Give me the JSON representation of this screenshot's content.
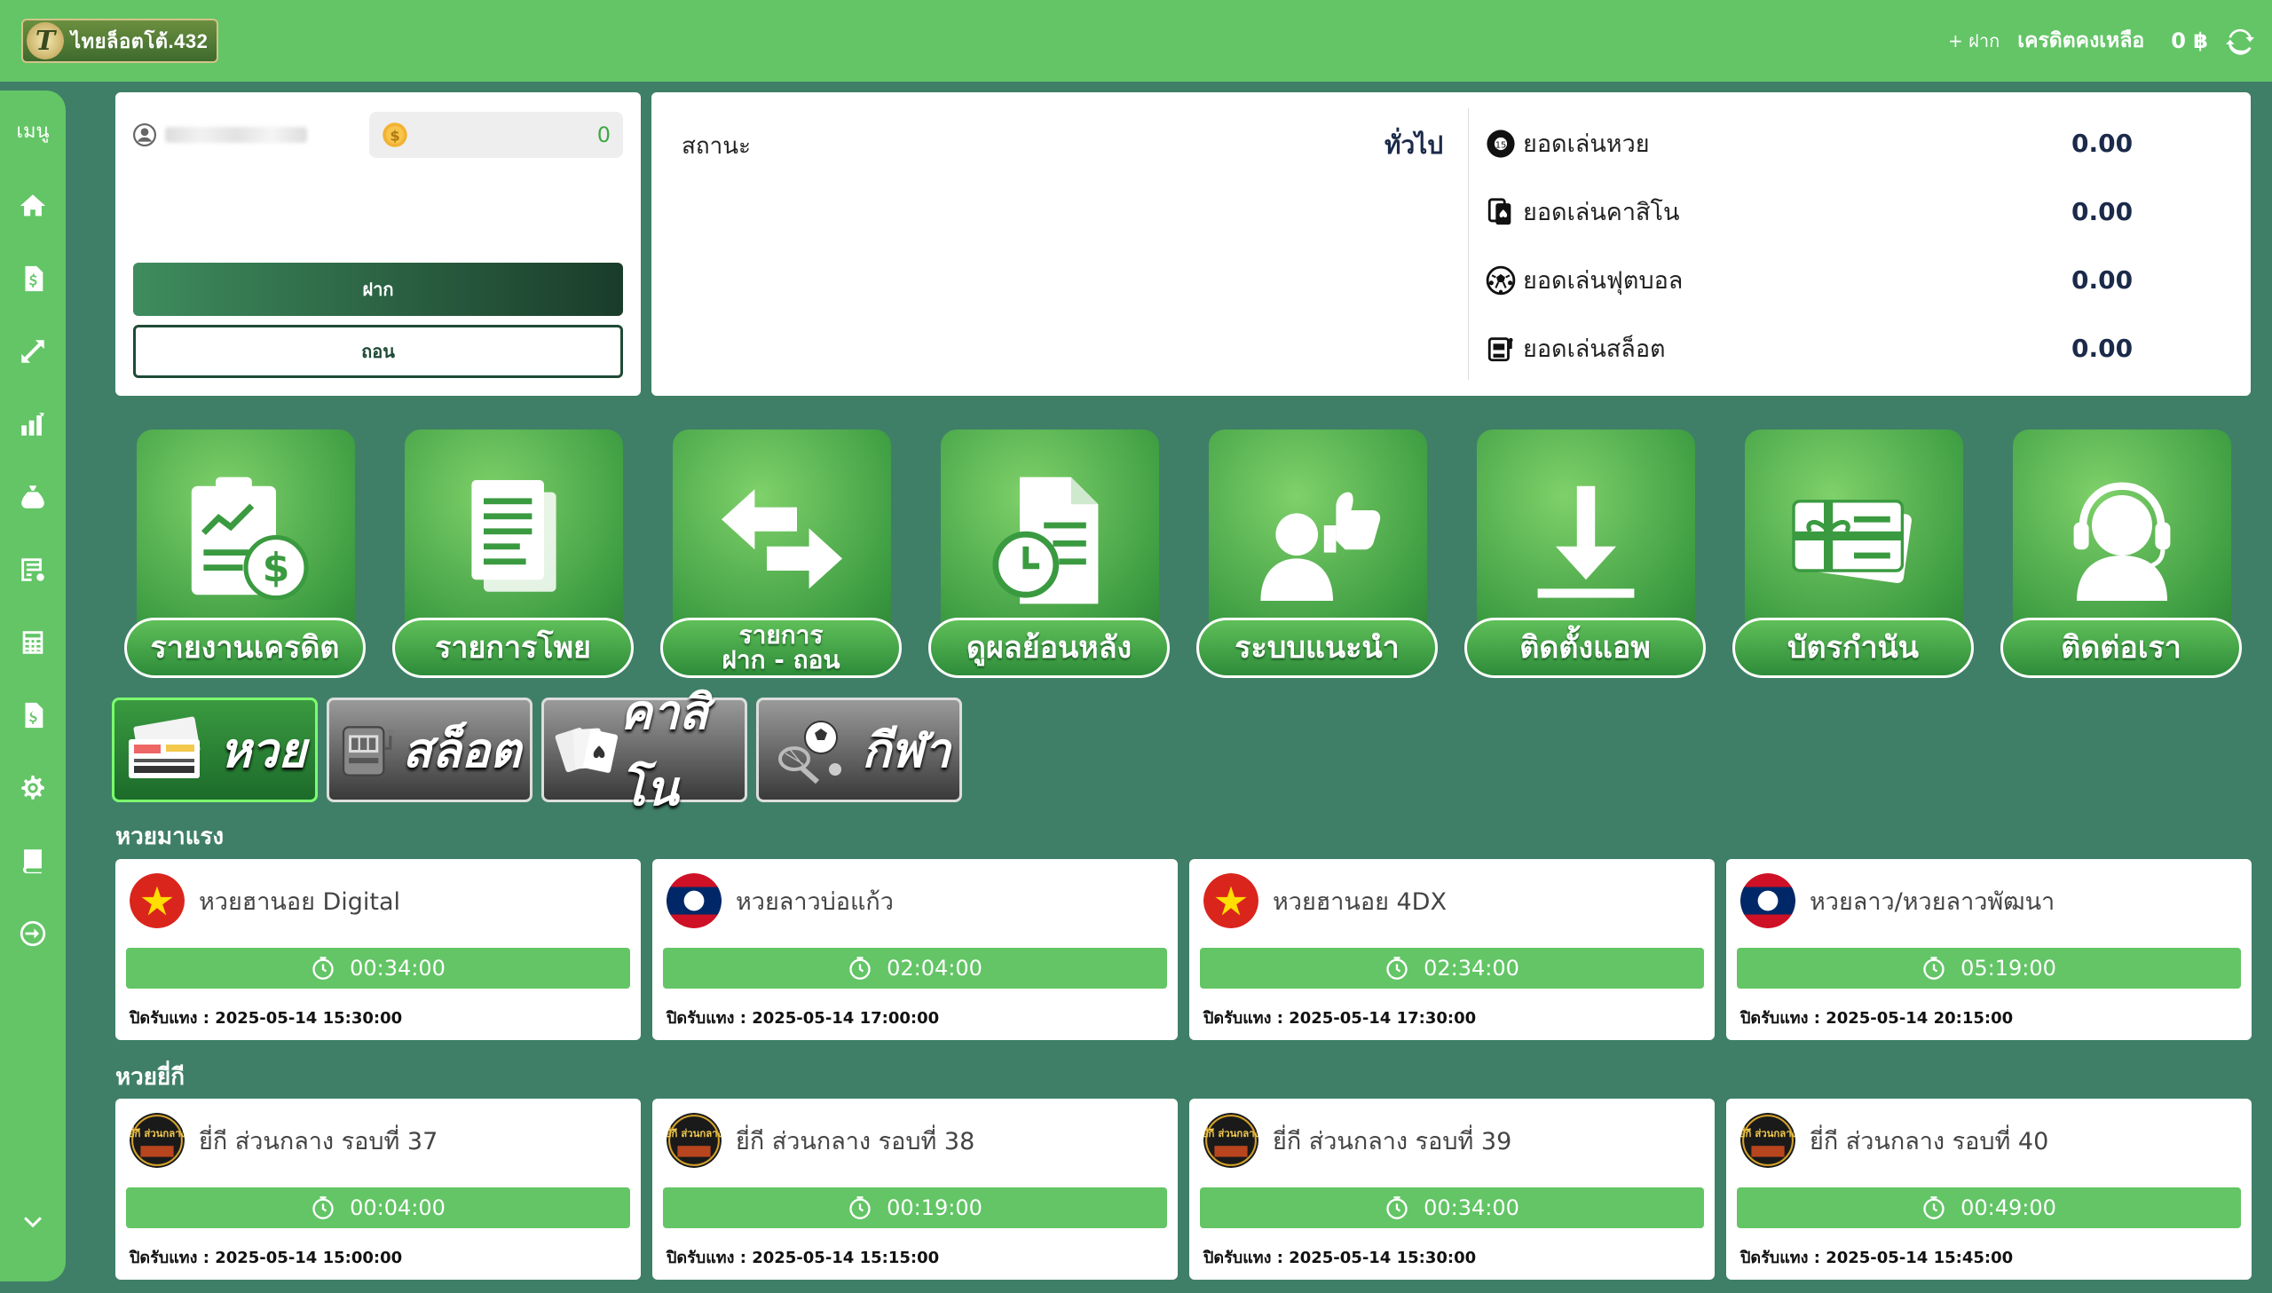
{
  "header": {
    "logo_text": "ไทยล็อตโต้.432",
    "deposit_link": "+ ฝาก",
    "credit_label": "เครดิตคงเหลือ",
    "credit_value": "0 ฿"
  },
  "sidebar": {
    "menu_label": "เมนู",
    "items": [
      "home-icon",
      "bill-icon",
      "transfer-icon",
      "chart-icon",
      "money-bag-icon",
      "list-icon",
      "calculator-icon",
      "document-dollar-icon",
      "settings-icon",
      "book-icon",
      "logout-icon"
    ]
  },
  "profile": {
    "balance": "0",
    "deposit_button": "ฝาก",
    "withdraw_button": "ถอน"
  },
  "status": {
    "label": "สถานะ",
    "type": "ทั่วไป",
    "stats": [
      {
        "label": "ยอดเล่นหวย",
        "value": "0.00",
        "icon": "lottery-ball-icon"
      },
      {
        "label": "ยอดเล่นคาสิโน",
        "value": "0.00",
        "icon": "cards-icon"
      },
      {
        "label": "ยอดเล่นฟุตบอล",
        "value": "0.00",
        "icon": "soccer-ball-icon"
      },
      {
        "label": "ยอดเล่นสล็อต",
        "value": "0.00",
        "icon": "slot-machine-icon"
      }
    ]
  },
  "tiles": [
    {
      "label": "รายงานเครดิต",
      "icon": "credit-report-icon"
    },
    {
      "label": "รายการโพย",
      "icon": "documents-icon"
    },
    {
      "label": "รายการ\nฝาก - ถอน",
      "icon": "exchange-arrows-icon"
    },
    {
      "label": "ดูผลย้อนหลัง",
      "icon": "history-document-icon"
    },
    {
      "label": "ระบบแนะนำ",
      "icon": "referral-icon"
    },
    {
      "label": "ติดตั้งแอพ",
      "icon": "download-icon"
    },
    {
      "label": "บัตรกำนัน",
      "icon": "gift-card-icon"
    },
    {
      "label": "ติดต่อเรา",
      "icon": "support-agent-icon"
    }
  ],
  "tabs": [
    {
      "label": "หวย",
      "icon": "lottery-ticket-icon",
      "active": true
    },
    {
      "label": "สล็อต",
      "icon": "slot-machine-icon",
      "active": false
    },
    {
      "label": "คาสิโน",
      "icon": "playing-cards-icon",
      "active": false
    },
    {
      "label": "กีฬา",
      "icon": "sports-icon",
      "active": false
    }
  ],
  "sections": [
    {
      "title": "หวยมาแรง",
      "cards": [
        {
          "name": "หวยฮานอย Digital",
          "flag": "vietnam",
          "timer": "00:34:00",
          "close": "ปิดรับแทง : 2025-05-14 15:30:00"
        },
        {
          "name": "หวยลาวบ่อแก้ว",
          "flag": "laos",
          "timer": "02:04:00",
          "close": "ปิดรับแทง : 2025-05-14 17:00:00"
        },
        {
          "name": "หวยฮานอย 4DX",
          "flag": "vietnam",
          "timer": "02:34:00",
          "close": "ปิดรับแทง : 2025-05-14 17:30:00"
        },
        {
          "name": "หวยลาว/หวยลาวพัฒนา",
          "flag": "laos",
          "timer": "05:19:00",
          "close": "ปิดรับแทง : 2025-05-14 20:15:00"
        }
      ]
    },
    {
      "title": "หวยยี่กี",
      "cards": [
        {
          "name": "ยี่กี ส่วนกลาง รอบที่ 37",
          "flag": "yeekee",
          "timer": "00:04:00",
          "close": "ปิดรับแทง : 2025-05-14 15:00:00"
        },
        {
          "name": "ยี่กี ส่วนกลาง รอบที่ 38",
          "flag": "yeekee",
          "timer": "00:19:00",
          "close": "ปิดรับแทง : 2025-05-14 15:15:00"
        },
        {
          "name": "ยี่กี ส่วนกลาง รอบที่ 39",
          "flag": "yeekee",
          "timer": "00:34:00",
          "close": "ปิดรับแทง : 2025-05-14 15:30:00"
        },
        {
          "name": "ยี่กี ส่วนกลาง รอบที่ 40",
          "flag": "yeekee",
          "timer": "00:49:00",
          "close": "ปิดรับแทง : 2025-05-14 15:45:00"
        }
      ]
    }
  ],
  "yeekee_badge_text": "ยี่กี ส่วนกลาง",
  "colors": {
    "primary": "#63c566",
    "background": "#3f7f68",
    "dark_text": "#1b2a4a"
  }
}
